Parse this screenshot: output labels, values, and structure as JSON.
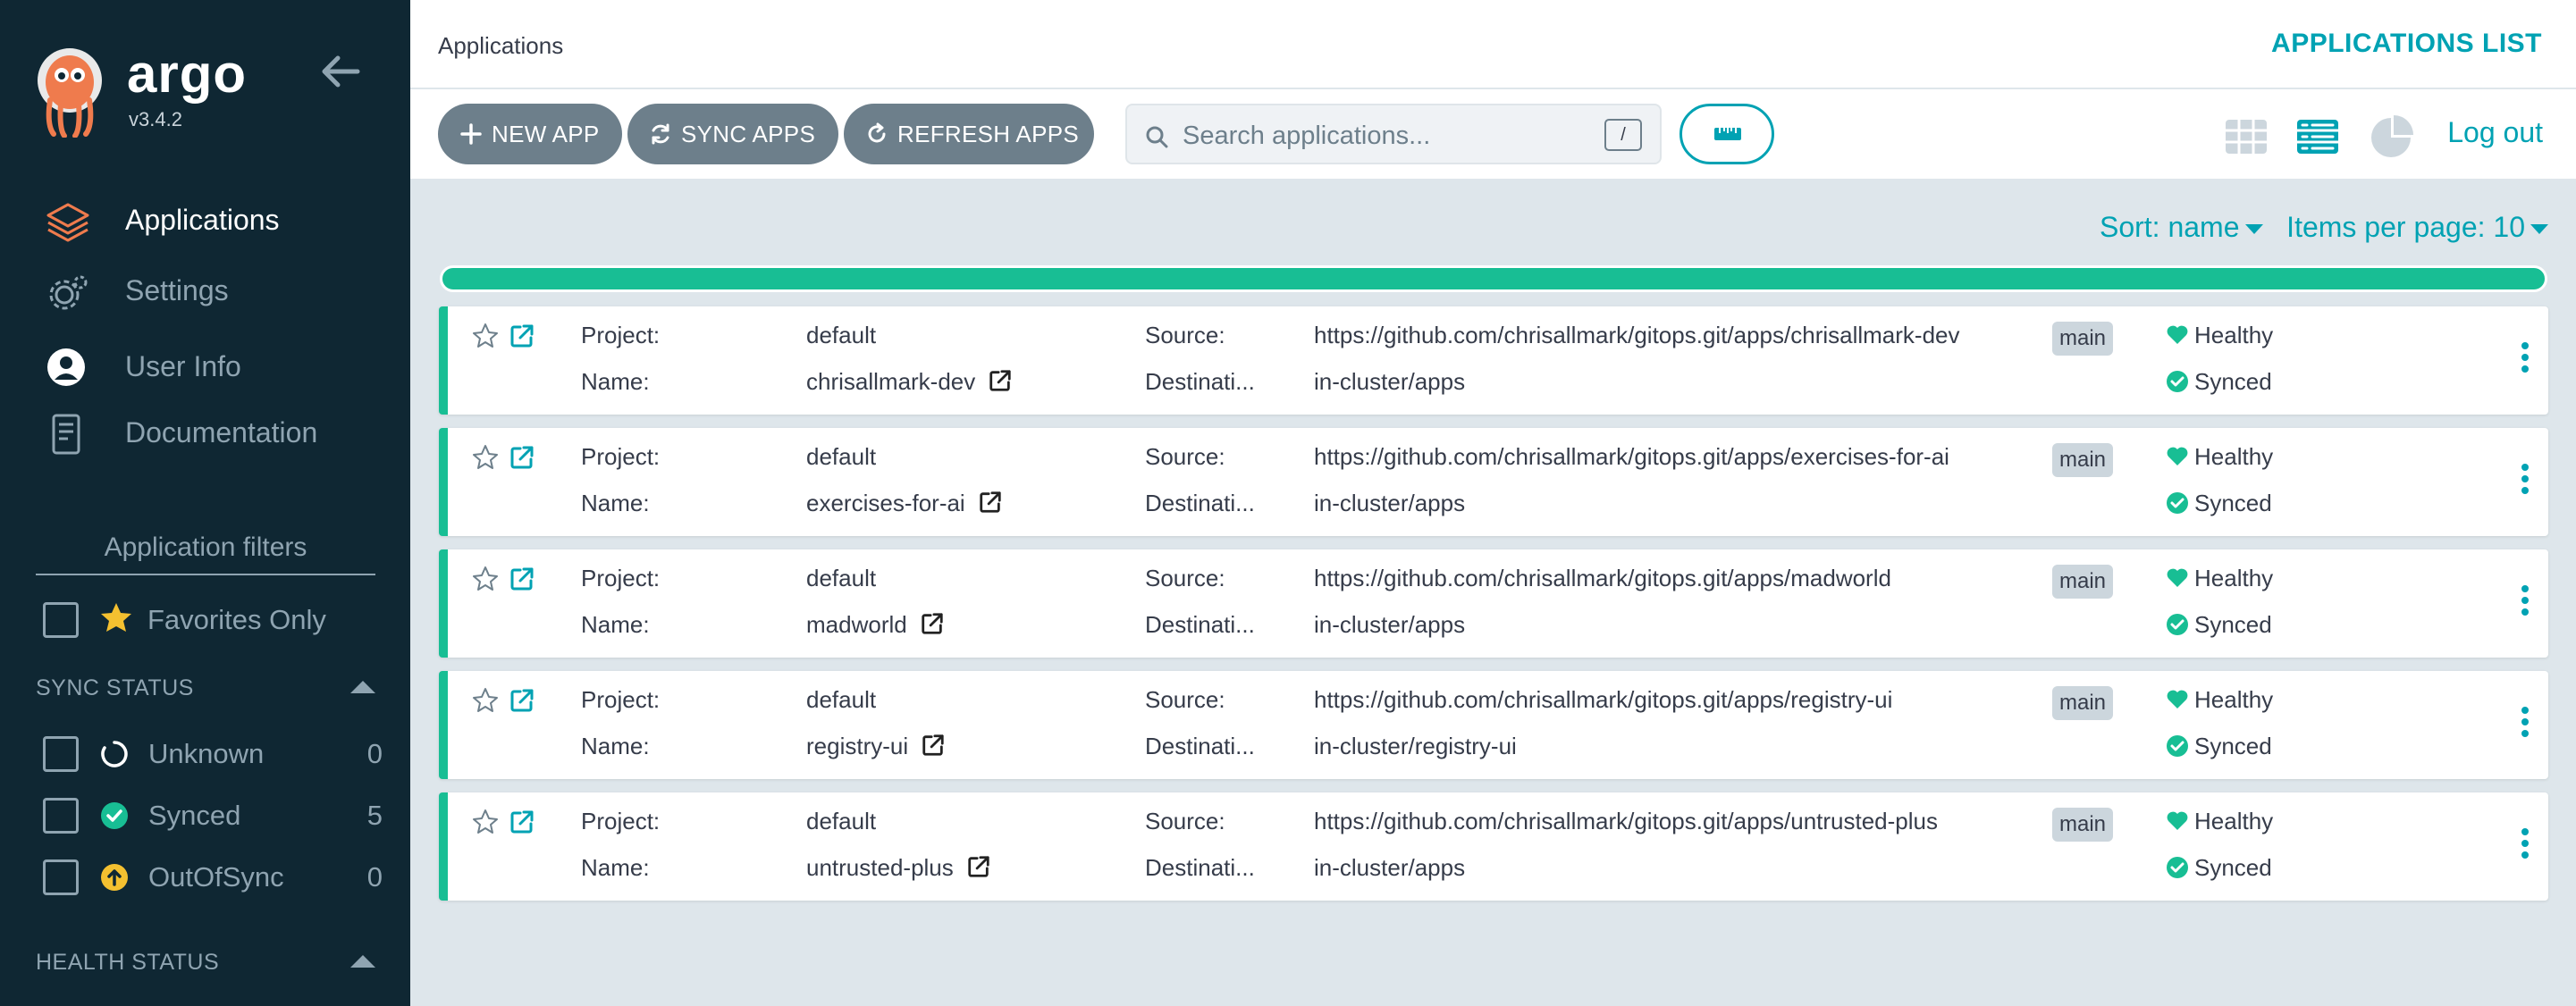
{
  "app": {
    "brand": "argo",
    "version": "v3.4.2"
  },
  "sidebar": {
    "nav": [
      {
        "label": "Applications",
        "icon": "layers-icon",
        "active": true
      },
      {
        "label": "Settings",
        "icon": "gear-icon",
        "active": false
      },
      {
        "label": "User Info",
        "icon": "user-circle-icon",
        "active": false
      },
      {
        "label": "Documentation",
        "icon": "book-icon",
        "active": false
      }
    ],
    "filters_title": "Application filters",
    "favorites_label": "Favorites Only",
    "sync_status": {
      "title": "SYNC STATUS",
      "items": [
        {
          "label": "Unknown",
          "count": "0",
          "icon": "circle-notch-icon"
        },
        {
          "label": "Synced",
          "count": "5",
          "icon": "check-circle-icon"
        },
        {
          "label": "OutOfSync",
          "count": "0",
          "icon": "arrow-up-circle-icon"
        }
      ]
    },
    "health_status": {
      "title": "HEALTH STATUS"
    }
  },
  "topbar": {
    "breadcrumb": "Applications",
    "page_label": "APPLICATIONS LIST"
  },
  "toolbar": {
    "new_app": "NEW APP",
    "sync_apps": "SYNC APPS",
    "refresh_apps": "REFRESH APPS",
    "search_placeholder": "Search applications...",
    "search_shortcut": "/",
    "logout": "Log out"
  },
  "sort": {
    "sort_label": "Sort: name",
    "per_page_label": "Items per page: 10"
  },
  "labels": {
    "project": "Project:",
    "name": "Name:",
    "source": "Source:",
    "destination": "Destinati..."
  },
  "colors": {
    "accent": "#00a2b3",
    "healthy": "#18be94",
    "sidebar_bg": "#0f2733",
    "button_bg": "#6d7f8b"
  },
  "applications": [
    {
      "project": "default",
      "name": "chrisallmark-dev",
      "source": "https://github.com/chrisallmark/gitops.git/apps/chrisallmark-dev",
      "destination": "in-cluster/apps",
      "revision": "main",
      "health": "Healthy",
      "sync": "Synced"
    },
    {
      "project": "default",
      "name": "exercises-for-ai",
      "source": "https://github.com/chrisallmark/gitops.git/apps/exercises-for-ai",
      "destination": "in-cluster/apps",
      "revision": "main",
      "health": "Healthy",
      "sync": "Synced"
    },
    {
      "project": "default",
      "name": "madworld",
      "source": "https://github.com/chrisallmark/gitops.git/apps/madworld",
      "destination": "in-cluster/apps",
      "revision": "main",
      "health": "Healthy",
      "sync": "Synced"
    },
    {
      "project": "default",
      "name": "registry-ui",
      "source": "https://github.com/chrisallmark/gitops.git/apps/registry-ui",
      "destination": "in-cluster/registry-ui",
      "revision": "main",
      "health": "Healthy",
      "sync": "Synced"
    },
    {
      "project": "default",
      "name": "untrusted-plus",
      "source": "https://github.com/chrisallmark/gitops.git/apps/untrusted-plus",
      "destination": "in-cluster/apps",
      "revision": "main",
      "health": "Healthy",
      "sync": "Synced"
    }
  ]
}
